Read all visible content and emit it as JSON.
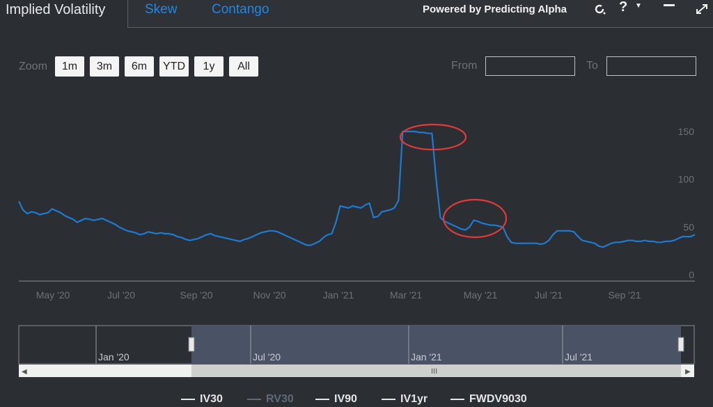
{
  "tabs": {
    "active": "Implied Volatility",
    "skew": "Skew",
    "contango": "Contango"
  },
  "header": {
    "powered_by": "Powered by Predicting Alpha"
  },
  "zoom": {
    "label": "Zoom",
    "buttons": [
      "1m",
      "3m",
      "6m",
      "YTD",
      "1y",
      "All"
    ]
  },
  "range": {
    "from_label": "From",
    "to_label": "To",
    "from_value": "",
    "to_value": ""
  },
  "chart_data": {
    "type": "line",
    "yticks": [
      "150",
      "100",
      "50",
      "0"
    ],
    "ylim": [
      0,
      155
    ],
    "xticks": [
      "May '20",
      "Jul '20",
      "Sep '20",
      "Nov '20",
      "Jan '21",
      "Mar '21",
      "May '21",
      "Jul '21",
      "Sep '21"
    ],
    "series": [
      {
        "name": "RV30",
        "color": "#1e7bd0",
        "values": [
          77,
          68,
          64,
          66,
          65,
          63,
          64,
          65,
          69,
          67,
          65,
          62,
          60,
          58,
          55,
          57,
          59,
          58,
          57,
          58,
          59,
          57,
          55,
          53,
          50,
          48,
          46,
          45,
          44,
          42,
          43,
          45,
          44,
          43,
          44,
          43,
          43,
          42,
          40,
          39,
          37,
          36,
          37,
          38,
          40,
          42,
          43,
          41,
          40,
          39,
          38,
          37,
          36,
          35,
          37,
          38,
          40,
          42,
          44,
          45,
          46,
          46,
          45,
          43,
          41,
          39,
          37,
          35,
          33,
          31,
          31,
          33,
          35,
          39,
          42,
          43,
          55,
          72,
          71,
          70,
          72,
          71,
          70,
          73,
          75,
          60,
          61,
          66,
          67,
          68,
          70,
          78,
          150,
          150,
          150,
          150,
          149,
          149,
          148,
          148,
          100,
          60,
          56,
          54,
          52,
          50,
          48,
          47,
          50,
          57,
          56,
          54,
          53,
          52,
          52,
          51,
          50,
          40,
          34,
          33,
          33,
          33,
          33,
          33,
          33,
          32,
          33,
          36,
          42,
          46,
          46,
          46,
          46,
          45,
          40,
          36,
          35,
          34,
          33,
          30,
          29,
          31,
          33,
          34,
          34,
          35,
          36,
          36,
          35,
          35,
          36,
          35,
          35,
          34,
          34,
          35,
          35,
          36,
          38,
          40,
          40,
          40,
          42
        ]
      }
    ],
    "navigator": {
      "labels": [
        "Jan '20",
        "Jul '20",
        "Jan '21",
        "Jul '21"
      ]
    }
  },
  "legend": [
    {
      "label": "IV30",
      "active": true
    },
    {
      "label": "RV30",
      "active": false
    },
    {
      "label": "IV90",
      "active": true
    },
    {
      "label": "IV1yr",
      "active": true
    },
    {
      "label": "FWDV9030",
      "active": true
    }
  ]
}
